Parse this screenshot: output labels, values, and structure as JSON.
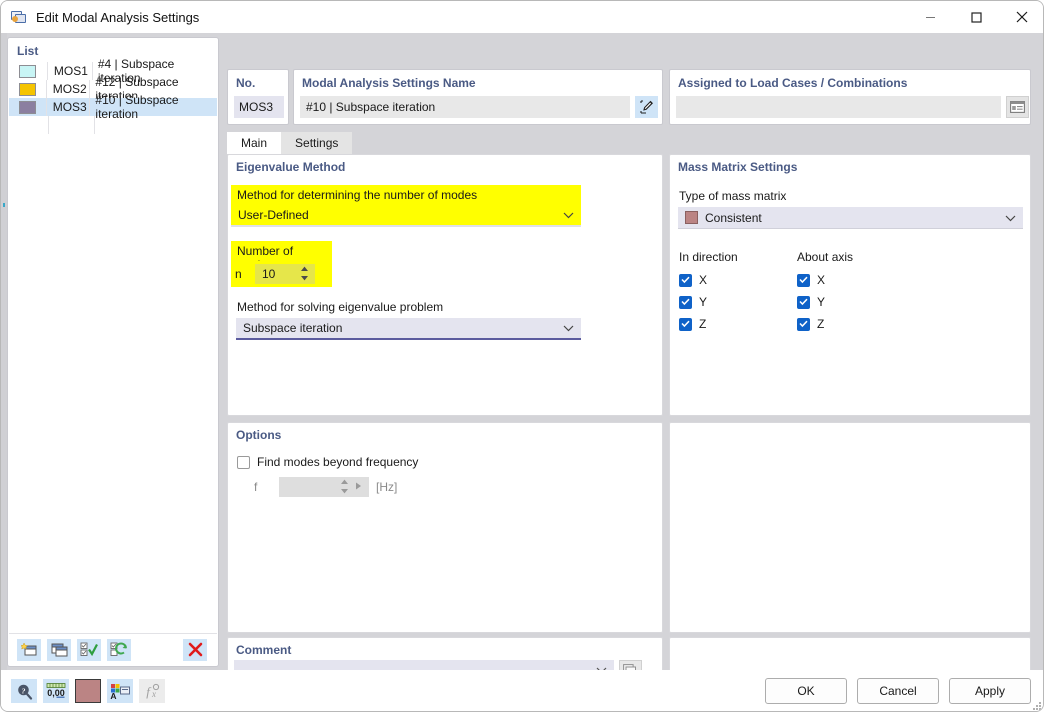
{
  "window": {
    "title": "Edit Modal Analysis Settings",
    "icon": "modal-settings-icon",
    "minimize": "–",
    "maximize": "□",
    "close": "✕"
  },
  "list": {
    "title": "List",
    "rows": [
      {
        "code": "MOS1",
        "desc": "#4 | Subspace iteration",
        "color": "#c8f5f5",
        "selected": false
      },
      {
        "code": "MOS2",
        "desc": "#12 | Subspace iteration",
        "color": "#f5c400",
        "selected": false
      },
      {
        "code": "MOS3",
        "desc": "#10 | Subspace iteration",
        "color": "#8b7fa0",
        "selected": true
      }
    ],
    "toolbar": [
      {
        "name": "new-item-icon",
        "title": "New"
      },
      {
        "name": "copy-item-icon",
        "title": "Copy"
      },
      {
        "name": "select-all-icon",
        "title": "Select All"
      },
      {
        "name": "invert-selection-icon",
        "title": "Invert Selection"
      }
    ],
    "delete": {
      "name": "delete-icon",
      "title": "Delete"
    }
  },
  "header": {
    "no_label": "No.",
    "no_value": "MOS3",
    "name_label": "Modal Analysis Settings Name",
    "name_value": "#10 | Subspace iteration",
    "name_edit_icon": "edit-pencil-icon",
    "assigned_label": "Assigned to Load Cases / Combinations",
    "assigned_value": "",
    "assigned_icon": "load-cases-icon"
  },
  "tabs": [
    {
      "label": "Main",
      "active": true
    },
    {
      "label": "Settings",
      "active": false
    }
  ],
  "eigenvalue": {
    "title": "Eigenvalue Method",
    "method_modes_label": "Method for determining the number of modes",
    "method_modes_value": "User-Defined",
    "number_of_modes_label": "Number of modes",
    "n_symbol": "n",
    "n_value": "10",
    "solving_label": "Method for solving eigenvalue problem",
    "solving_value": "Subspace iteration"
  },
  "mass": {
    "title": "Mass Matrix Settings",
    "type_label": "Type of mass matrix",
    "type_value": "Consistent",
    "type_color": "#bb8484",
    "in_direction_label": "In direction",
    "about_axis_label": "About axis",
    "in_direction": [
      {
        "label": "X",
        "checked": true
      },
      {
        "label": "Y",
        "checked": true
      },
      {
        "label": "Z",
        "checked": true
      }
    ],
    "about_axis": [
      {
        "label": "X",
        "checked": true
      },
      {
        "label": "Y",
        "checked": true
      },
      {
        "label": "Z",
        "checked": true
      }
    ]
  },
  "options": {
    "title": "Options",
    "find_modes_label": "Find modes beyond frequency",
    "find_modes_checked": false,
    "f_symbol": "f",
    "f_value": "",
    "f_unit": "[Hz]"
  },
  "comment": {
    "title": "Comment",
    "value": "",
    "button_icon": "comment-templates-icon"
  },
  "footer": {
    "tools": [
      {
        "name": "help-search-icon",
        "label": ""
      },
      {
        "name": "decimal-places-icon",
        "label": "0,00"
      },
      {
        "name": "color-swatch",
        "label": ""
      },
      {
        "name": "color-picker-icon",
        "label": ""
      },
      {
        "name": "formula-icon",
        "label": "fx",
        "disabled": true
      }
    ],
    "buttons": [
      {
        "label": "OK"
      },
      {
        "label": "Cancel"
      },
      {
        "label": "Apply"
      }
    ]
  }
}
